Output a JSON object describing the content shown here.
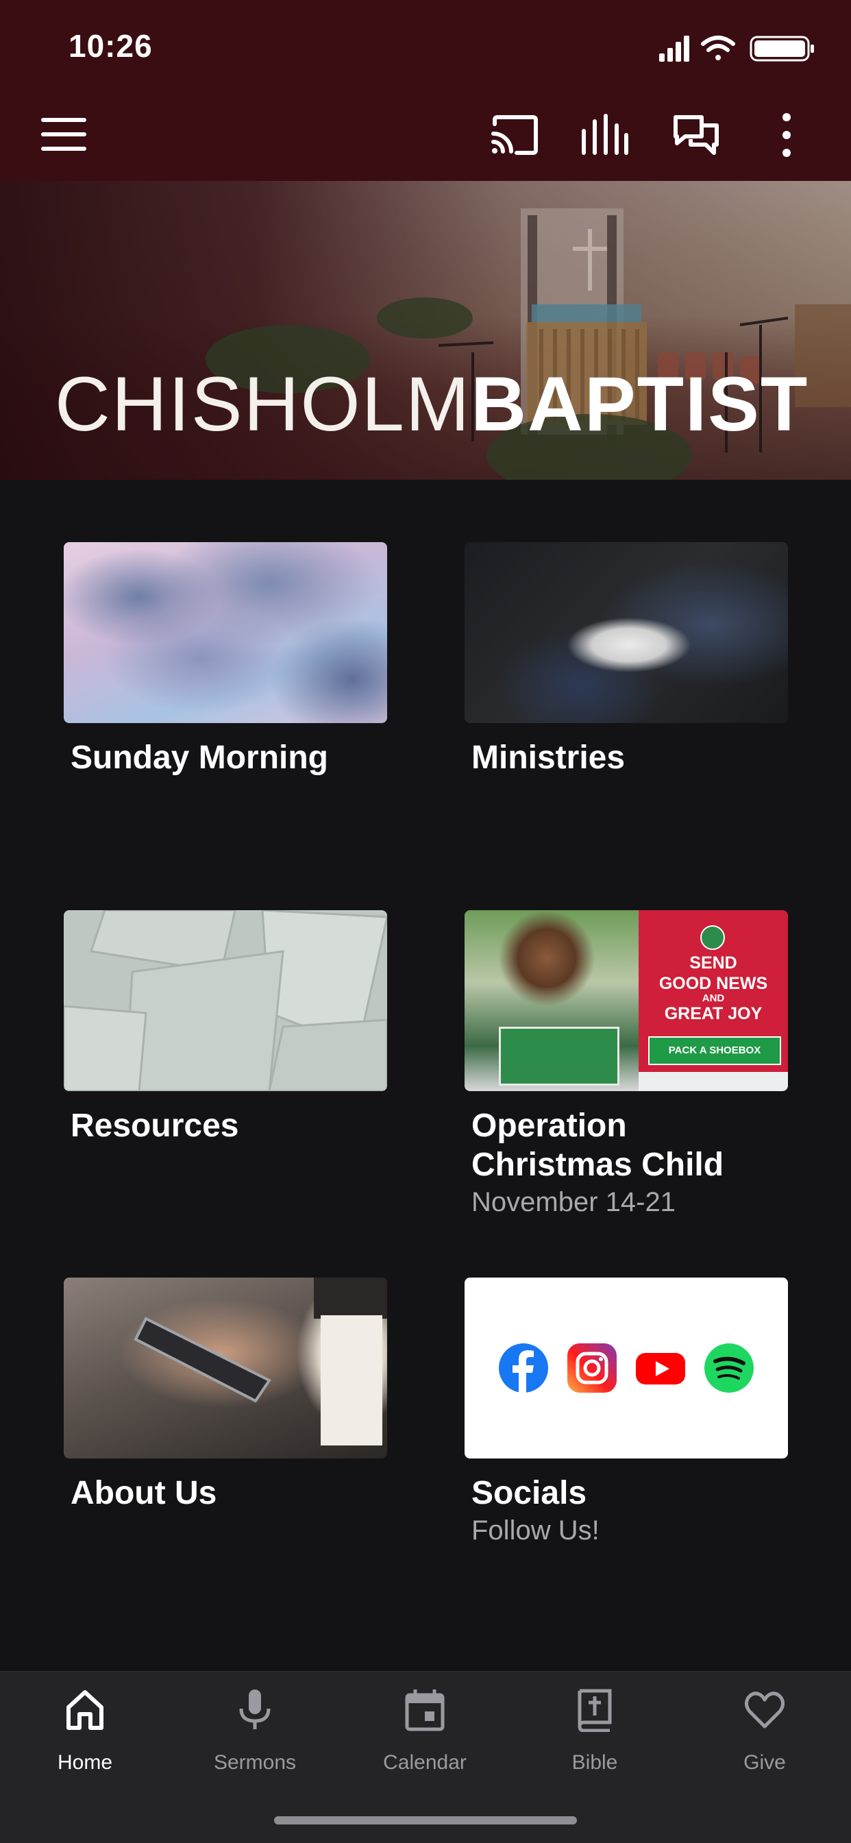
{
  "status_bar": {
    "time": "10:26"
  },
  "brand": {
    "title_light": "CHISHOLM",
    "title_bold": "BAPTIST"
  },
  "toolbar": {
    "icons": [
      "menu-icon",
      "cast-icon",
      "audio-bars-icon",
      "chat-icon",
      "more-vertical-icon"
    ]
  },
  "tiles": [
    {
      "title": "Sunday Morning",
      "subtitle": ""
    },
    {
      "title": "Ministries",
      "subtitle": ""
    },
    {
      "title": "Resources",
      "subtitle": ""
    },
    {
      "title": "Operation Christmas Child",
      "subtitle": "November 14-21"
    },
    {
      "title": "About Us",
      "subtitle": ""
    },
    {
      "title": "Socials",
      "subtitle": "Follow Us!"
    }
  ],
  "occ_graphic": {
    "line1": "SEND",
    "line2": "GOOD NEWS",
    "line3": "AND",
    "line4": "GREAT JOY",
    "button": "PACK A SHOEBOX"
  },
  "social_icons": [
    "facebook-icon",
    "instagram-icon",
    "youtube-icon",
    "spotify-icon"
  ],
  "bottom_nav": [
    {
      "label": "Home",
      "icon": "home-icon",
      "active": true
    },
    {
      "label": "Sermons",
      "icon": "microphone-icon",
      "active": false
    },
    {
      "label": "Calendar",
      "icon": "calendar-icon",
      "active": false
    },
    {
      "label": "Bible",
      "icon": "bible-icon",
      "active": false
    },
    {
      "label": "Give",
      "icon": "heart-icon",
      "active": false
    }
  ],
  "colors": {
    "header": "#3a0d13",
    "background": "#131316",
    "nav_background": "#242427",
    "inactive": "#9a9aa0"
  }
}
